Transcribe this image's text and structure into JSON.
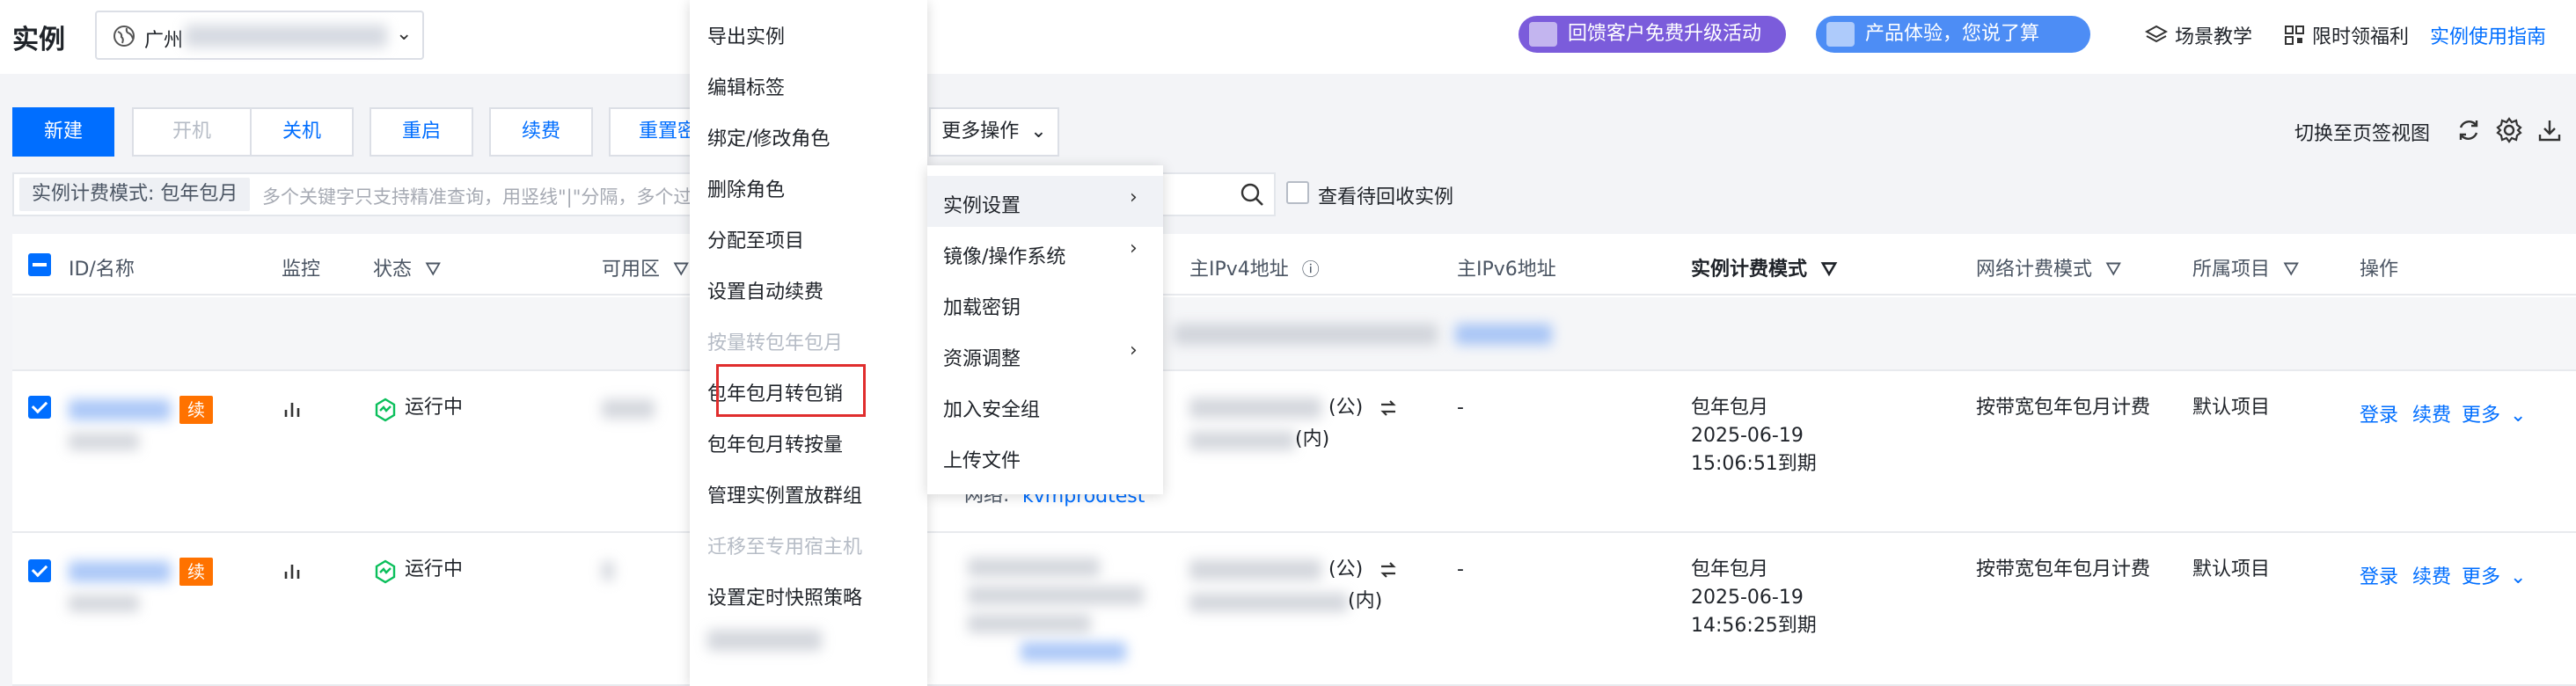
{
  "header": {
    "title": "实例",
    "region": "广州",
    "promo_feedback": "回馈客户免费升级活动",
    "promo_experience": "产品体验，您说了算",
    "scene_teach": "场景教学",
    "limited_welfare": "限时领福利",
    "usage_guide": "实例使用指南"
  },
  "toolbar": {
    "new": "新建",
    "power_on": "开机",
    "power_off": "关机",
    "restart": "重启",
    "renew": "续费",
    "reset_pwd": "重置密码",
    "more_actions": "更多操作",
    "switch_view": "切换至页签视图"
  },
  "search": {
    "filter_tag": "实例计费模式: 包年包月",
    "placeholder": "多个关键字只支持精准查询，用竖线\"|\"分隔，多个过",
    "recycle_label": "查看待回收实例"
  },
  "table": {
    "headers": {
      "id_name": "ID/名称",
      "monitor": "监控",
      "status": "状态",
      "zone": "可用区",
      "ipv4": "主IPv4地址",
      "ipv6": "主IPv6地址",
      "billing": "实例计费模式",
      "network_billing": "网络计费模式",
      "project": "所属项目",
      "actions": "操作"
    },
    "rows": [
      {
        "badge": "续",
        "status": "运行中",
        "public_suffix": "(公)",
        "private_suffix": "(内)",
        "ipv6": "-",
        "billing": "包年包月",
        "expire_date": "2025-06-19",
        "expire_time": "15:06:51到期",
        "network_billing": "按带宽包年包月计费",
        "project": "默认项目",
        "login": "登录",
        "renew": "续费",
        "more": "更多"
      },
      {
        "badge": "续",
        "status": "运行中",
        "public_suffix": "(公)",
        "private_suffix": "(内)",
        "ipv6": "-",
        "billing": "包年包月",
        "expire_date": "2025-06-19",
        "expire_time": "14:56:25到期",
        "network_billing": "按带宽包年包月计费",
        "project": "默认项目",
        "login": "登录",
        "renew": "续费",
        "more": "更多"
      }
    ],
    "network_prefix": "网络:",
    "network_value": "kvmprodtest"
  },
  "more_menu": {
    "items": [
      {
        "label": "导出实例",
        "disabled": false
      },
      {
        "label": "编辑标签",
        "disabled": false
      },
      {
        "label": "绑定/修改角色",
        "disabled": false
      },
      {
        "label": "删除角色",
        "disabled": false
      },
      {
        "label": "分配至项目",
        "disabled": false
      },
      {
        "label": "设置自动续费",
        "disabled": false
      },
      {
        "label": "按量转包年包月",
        "disabled": true
      },
      {
        "label": "包年包月转包销",
        "disabled": false,
        "highlighted": true
      },
      {
        "label": "包年包月转按量",
        "disabled": false
      },
      {
        "label": "管理实例置放群组",
        "disabled": false
      },
      {
        "label": "迁移至专用宿主机",
        "disabled": true
      },
      {
        "label": "设置定时快照策略",
        "disabled": false
      }
    ]
  },
  "sub_menu": {
    "items": [
      {
        "label": "实例设置",
        "has_submenu": true,
        "active": true
      },
      {
        "label": "镜像/操作系统",
        "has_submenu": true
      },
      {
        "label": "加载密钥",
        "has_submenu": false
      },
      {
        "label": "资源调整",
        "has_submenu": true
      },
      {
        "label": "加入安全组",
        "has_submenu": false
      },
      {
        "label": "上传文件",
        "has_submenu": false
      }
    ]
  },
  "colors": {
    "primary": "#006eff",
    "renew_badge": "#ff7200",
    "running": "#0abf5b",
    "highlight_box": "#e02d2d"
  }
}
